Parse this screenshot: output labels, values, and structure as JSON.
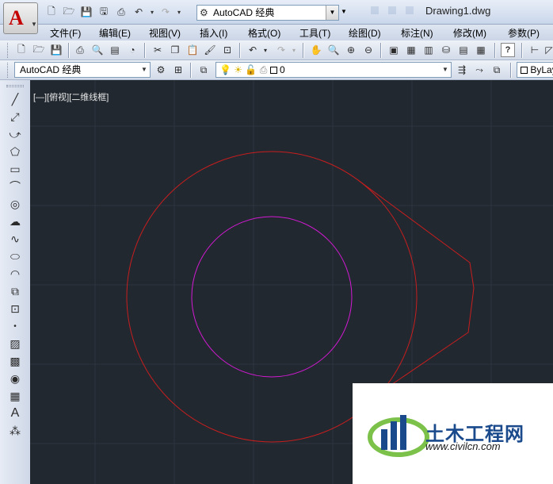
{
  "title_bar": {
    "workspace": "AutoCAD 经典",
    "document_title": "Drawing1.dwg"
  },
  "menu": [
    {
      "label": "文件(F)"
    },
    {
      "label": "编辑(E)"
    },
    {
      "label": "视图(V)"
    },
    {
      "label": "插入(I)"
    },
    {
      "label": "格式(O)"
    },
    {
      "label": "工具(T)"
    },
    {
      "label": "绘图(D)"
    },
    {
      "label": "标注(N)"
    },
    {
      "label": "修改(M)"
    },
    {
      "label": "参数(P)"
    }
  ],
  "toolbar2": {
    "workspace_combo": "AutoCAD 经典",
    "layer_combo": "0",
    "linetype_combo": "ByLay"
  },
  "viewport_label": "[—][俯视][二维线框]",
  "watermark": {
    "brand": "土木工程网",
    "url": "www.civilcn.com"
  },
  "colors": {
    "canvas_bg": "#212830",
    "outer_circle": "#c81e1e",
    "inner_circle": "#d21ad2",
    "grid": "#2d353f"
  },
  "icons": {
    "left_toolbar": [
      "line-icon",
      "construction-line-icon",
      "polyline-icon",
      "polygon-icon",
      "rectangle-icon",
      "arc-icon",
      "circle-icon",
      "revision-cloud-icon",
      "spline-icon",
      "ellipse-icon",
      "ellipse-arc-icon",
      "insert-block-icon",
      "make-block-icon",
      "point-icon",
      "hatch-icon",
      "gradient-icon",
      "region-icon",
      "table-icon",
      "text-icon",
      "add-selected-icon"
    ]
  }
}
